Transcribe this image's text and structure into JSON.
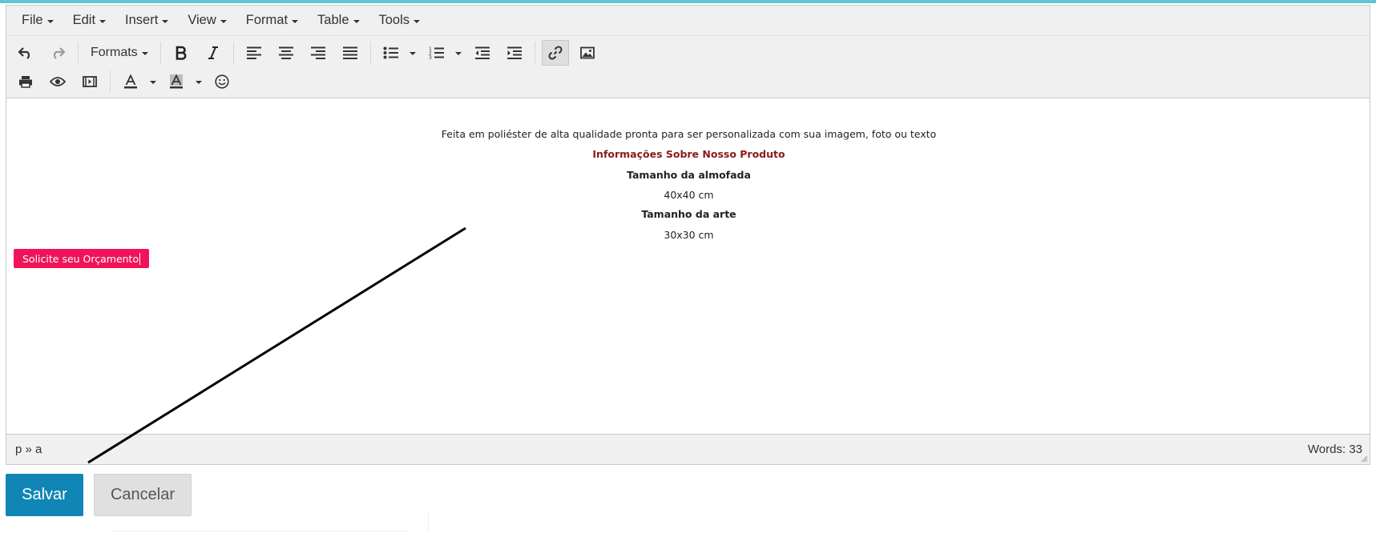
{
  "menubar": {
    "items": [
      {
        "label": "File"
      },
      {
        "label": "Edit"
      },
      {
        "label": "Insert"
      },
      {
        "label": "View"
      },
      {
        "label": "Format"
      },
      {
        "label": "Table"
      },
      {
        "label": "Tools"
      }
    ]
  },
  "toolbar": {
    "formats_label": "Formats",
    "row1_icons": [
      "undo-icon",
      "redo-icon",
      "bold-icon",
      "italic-icon",
      "align-left-icon",
      "align-center-icon",
      "align-right-icon",
      "align-justify-icon",
      "bullet-list-icon",
      "numbered-list-icon",
      "outdent-icon",
      "indent-icon",
      "link-icon",
      "image-icon"
    ],
    "row2_icons": [
      "print-icon",
      "preview-icon",
      "media-icon",
      "text-color-icon",
      "background-color-icon",
      "emoticon-icon"
    ],
    "active": "link-icon"
  },
  "content": {
    "lines": [
      "Feita em poliéster de alta qualidade pronta para ser personalizada com sua imagem, foto ou texto",
      "Informações Sobre Nosso Produto",
      "Tamanho da almofada",
      "40x40 cm",
      "Tamanho da arte",
      "30x30 cm"
    ],
    "cta_label": "Solicite seu Orçamento"
  },
  "statusbar": {
    "path": "p » a",
    "word_count": "Words: 33"
  },
  "actions": {
    "save_label": "Salvar",
    "cancel_label": "Cancelar"
  },
  "colors": {
    "accent_teal": "#5fc6d3",
    "save_blue": "#0f86b5",
    "cta_pink": "#f0135a",
    "heading_red": "#8b1a1a"
  }
}
